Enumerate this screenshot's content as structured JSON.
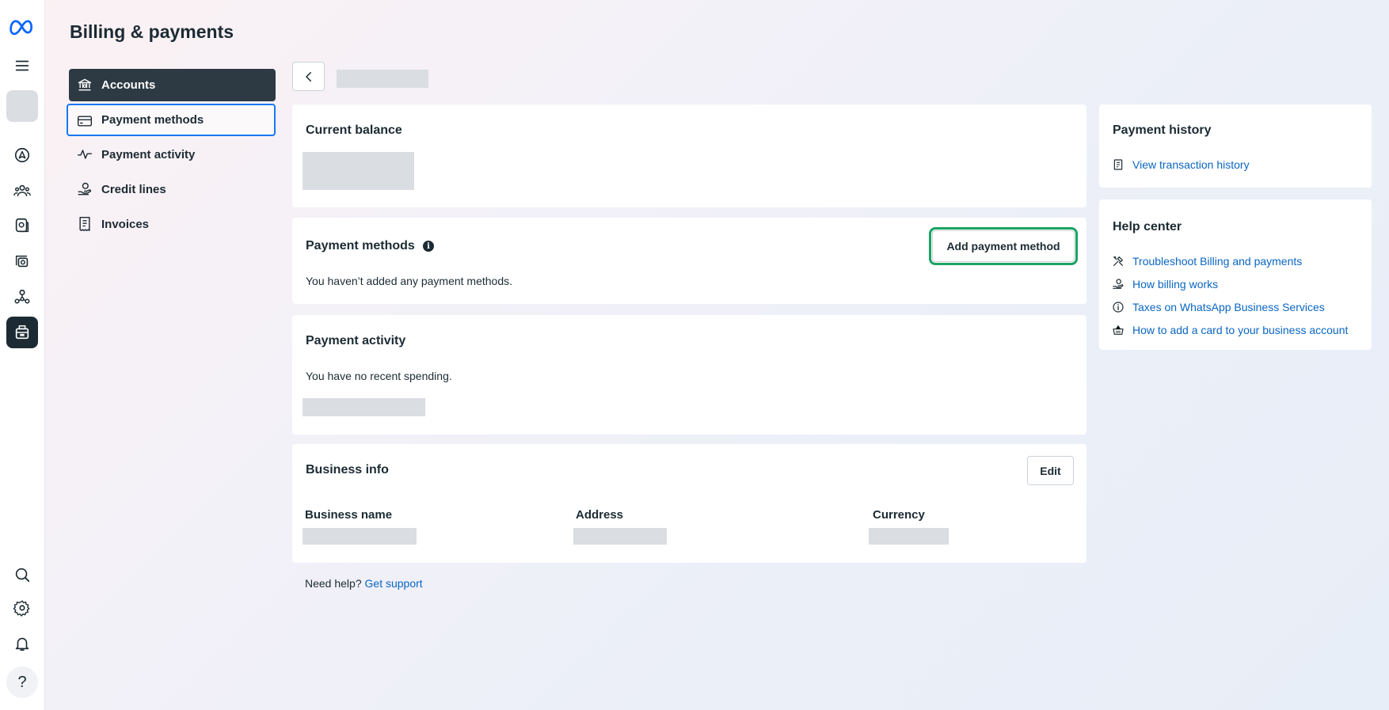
{
  "page": {
    "title": "Billing & payments"
  },
  "rail": {
    "items": [
      {
        "icon": "meta-logo-icon"
      },
      {
        "icon": "menu-icon"
      },
      {
        "icon": "account-avatar-placeholder"
      },
      {
        "icon": "compass-icon"
      },
      {
        "icon": "people-icon"
      },
      {
        "icon": "chat-icon"
      },
      {
        "icon": "data-icon"
      },
      {
        "icon": "network-icon"
      },
      {
        "icon": "billing-icon"
      },
      {
        "icon": "search-icon"
      },
      {
        "icon": "gear-icon"
      },
      {
        "icon": "bell-icon"
      },
      {
        "icon": "help-icon"
      }
    ],
    "help_label": "?"
  },
  "nav": {
    "items": [
      {
        "label": "Accounts",
        "icon": "bank-icon"
      },
      {
        "label": "Payment methods",
        "icon": "credit-card-icon"
      },
      {
        "label": "Payment activity",
        "icon": "activity-icon"
      },
      {
        "label": "Credit lines",
        "icon": "hand-coin-icon"
      },
      {
        "label": "Invoices",
        "icon": "receipt-icon"
      }
    ]
  },
  "balance": {
    "title": "Current balance"
  },
  "payment_methods": {
    "title": "Payment methods",
    "info_glyph": "i",
    "add_label": "Add payment method",
    "empty_text": "You haven’t added any payment methods."
  },
  "activity": {
    "title": "Payment activity",
    "empty_text": "You have no recent spending."
  },
  "business": {
    "title": "Business info",
    "edit_label": "Edit",
    "columns": [
      "Business name",
      "Address",
      "Currency"
    ]
  },
  "history": {
    "title": "Payment history",
    "link": "View transaction history"
  },
  "help_center": {
    "title": "Help center",
    "links": [
      {
        "label": "Troubleshoot Billing and payments",
        "icon": "tools-icon"
      },
      {
        "label": "How billing works",
        "icon": "hand-coin-icon"
      },
      {
        "label": "Taxes on WhatsApp Business Services",
        "icon": "info-circle-icon"
      },
      {
        "label": "How to add a card to your business account",
        "icon": "basket-icon"
      }
    ]
  },
  "footer": {
    "prefix": "Need help?",
    "link": "Get support"
  },
  "colors": {
    "link": "#0a66c2",
    "nav_active_bg": "#2d3a43",
    "focus_blue": "#1877f2",
    "focus_green": "#1aa363",
    "skeleton": "#dadde1"
  }
}
